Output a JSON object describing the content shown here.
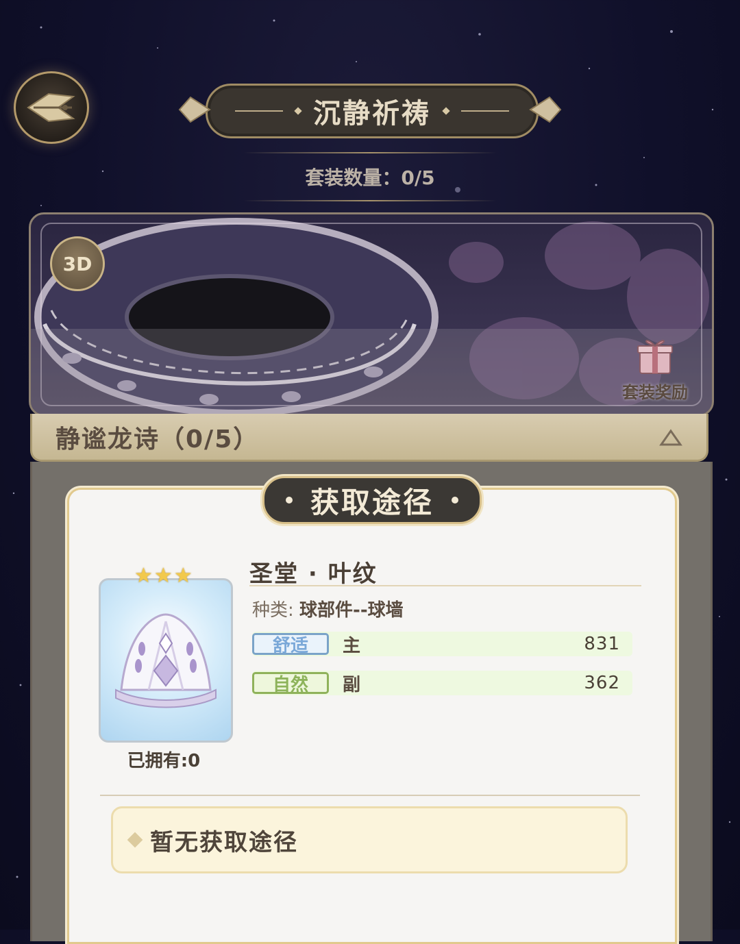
{
  "header": {
    "title": "沉静祈祷",
    "set_count": "套装数量：0/5"
  },
  "showcase": {
    "badge_3d": "3D",
    "reward_label": "套装奖励"
  },
  "set_section": {
    "title": "静谧龙诗（0/5）"
  },
  "dialog": {
    "title": "获取途径",
    "item": {
      "name": "圣堂 · 叶纹",
      "stars": 3,
      "owned": "已拥有:0",
      "type_label": "种类:",
      "type_value": "球部件--球墙",
      "stats": [
        {
          "tag": "舒适",
          "role": "主",
          "value": "831"
        },
        {
          "tag": "自然",
          "role": "副",
          "value": "362"
        }
      ]
    },
    "source_text": "暂无获取途径"
  },
  "colors": {
    "gold_border": "#d8c08a",
    "comfort_tag": "#7aa8d8",
    "natural_tag": "#8db35a",
    "star": "#f2c94c"
  },
  "icons": [
    "back-wing-icon",
    "gift-icon",
    "collapse-triangle-icon",
    "star-icon",
    "diamond-bullet-icon"
  ]
}
